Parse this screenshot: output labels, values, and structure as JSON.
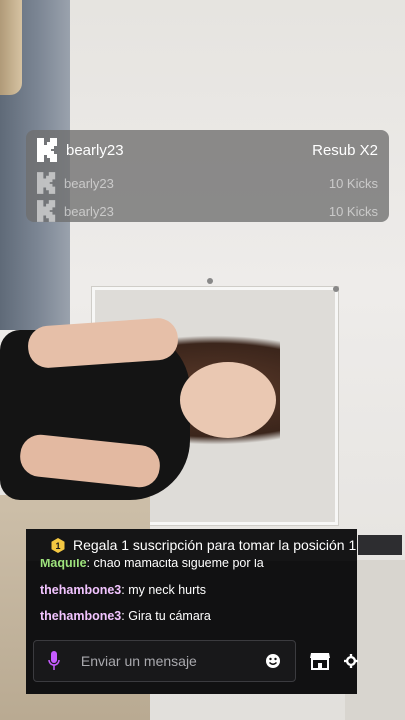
{
  "stream": {
    "background": "live-stream-video"
  },
  "subs": {
    "rows": [
      {
        "user": "bearly23",
        "amount": "Resub X2",
        "icon": "kick-logo-icon"
      },
      {
        "user": "bearly23",
        "amount": "10 Kicks",
        "icon": "kick-logo-icon"
      },
      {
        "user": "bearly23",
        "amount": "10 Kicks",
        "icon": "kick-logo-icon"
      }
    ]
  },
  "chat": {
    "banner": {
      "text": "Regala 1 suscripción para tomar la posición 1",
      "icon": "hexagon-badge-icon",
      "icon_color": "#f5c842"
    },
    "messages": [
      {
        "author": "Maquile",
        "text": "chao mamacita sigueme por la"
      },
      {
        "author": "thehambone3",
        "text": "my neck hurts"
      },
      {
        "author": "thehambone3",
        "text": "Gira tu cámara"
      }
    ],
    "input": {
      "placeholder": "Enviar un mensaje",
      "value": ""
    },
    "icons": {
      "mic": "microphone-icon",
      "emoji": "emoji-icon",
      "store": "store-icon",
      "settings": "gear-icon"
    },
    "accent": "#c55bff"
  }
}
